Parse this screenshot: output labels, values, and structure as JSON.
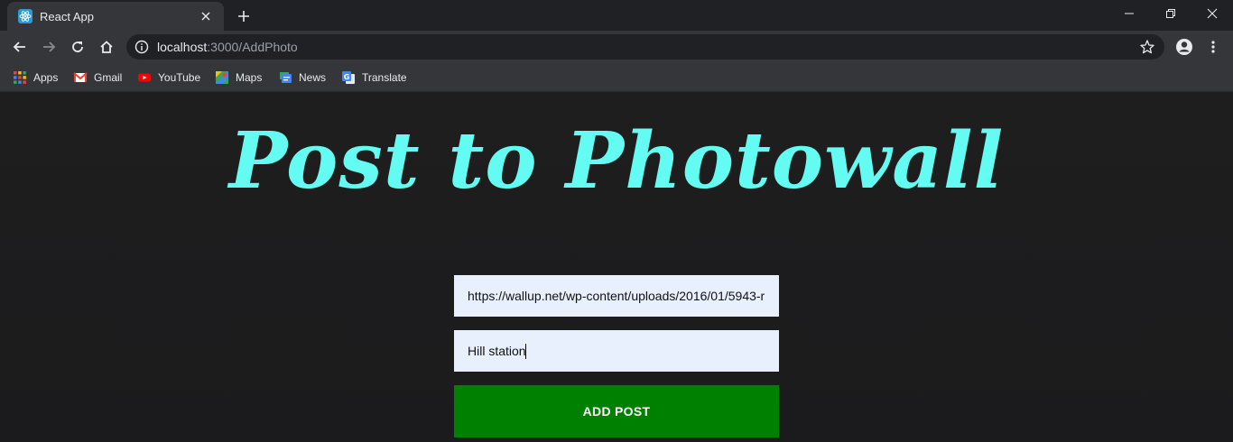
{
  "browser": {
    "tab": {
      "title": "React App",
      "favicon": "react-logo-icon"
    },
    "address": {
      "host": "localhost",
      "path": ":3000/AddPhoto"
    },
    "bookmarks": [
      {
        "label": "Apps",
        "icon": "apps-grid-icon"
      },
      {
        "label": "Gmail",
        "icon": "gmail-icon"
      },
      {
        "label": "YouTube",
        "icon": "youtube-icon"
      },
      {
        "label": "Maps",
        "icon": "maps-icon"
      },
      {
        "label": "News",
        "icon": "news-icon"
      },
      {
        "label": "Translate",
        "icon": "translate-icon"
      }
    ]
  },
  "page": {
    "title": "Post to Photowall",
    "title_color": "#64fbf2",
    "form": {
      "link_value": "https://wallup.net/wp-content/uploads/2016/01/5943-r",
      "description_value": "Hill station",
      "submit_label": "ADD POST",
      "submit_color": "#008000"
    }
  }
}
